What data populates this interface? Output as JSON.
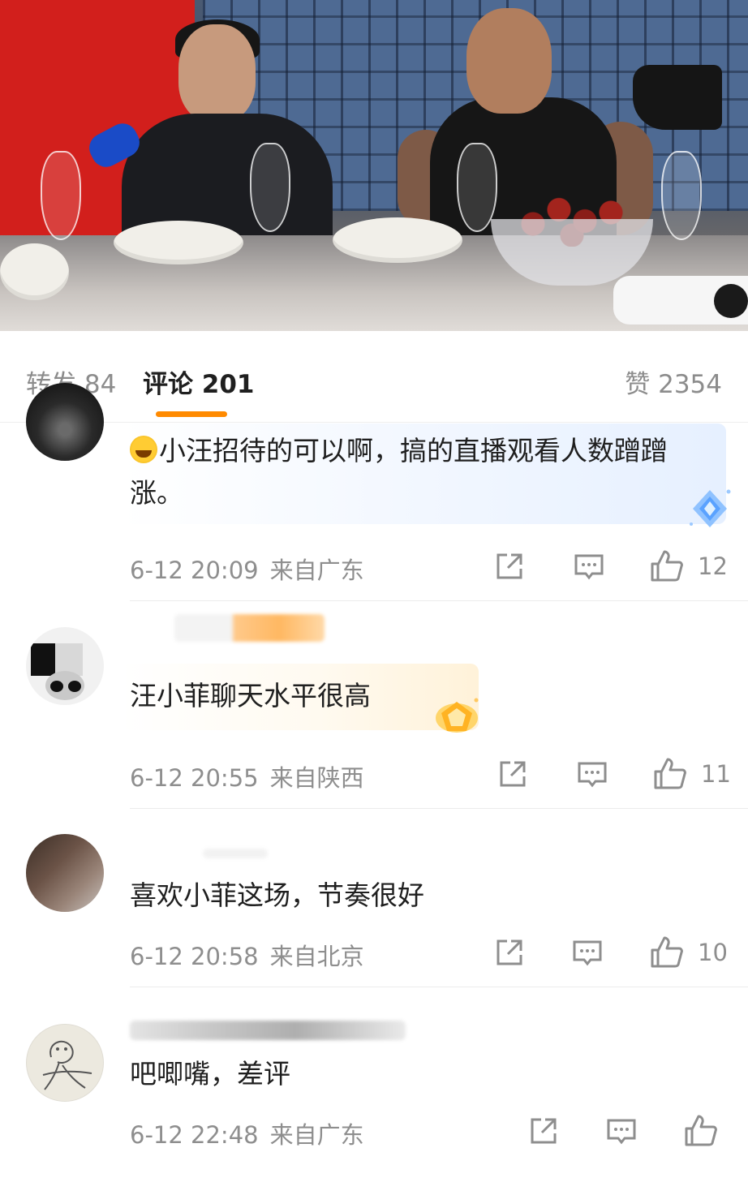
{
  "tabs": {
    "forward_label": "转发 84",
    "comments_label": "评论 201",
    "likes_label": "赞 2354",
    "active_color": "#ff8a00"
  },
  "comments": [
    {
      "text": "小汪招待的可以啊，搞的直播观看人数蹭蹭涨。",
      "emoji_icon": "laughing-crying-emoji",
      "time": "6-12 20:09",
      "location": "来自广东",
      "likes": "12",
      "badge_icon": "diamond-badge-icon"
    },
    {
      "text": "汪小菲聊天水平很高",
      "time": "6-12 20:55",
      "location": "来自陕西",
      "likes": "11",
      "badge_icon": "crown-badge-icon"
    },
    {
      "text": "喜欢小菲这场，节奏很好",
      "time": "6-12 20:58",
      "location": "来自北京",
      "likes": "10"
    },
    {
      "text": "吧唧嘴，差评",
      "time": "6-12 22:48",
      "location": "来自广东",
      "likes": ""
    }
  ],
  "icons": {
    "share": "share-icon",
    "reply": "comment-icon",
    "like": "thumbs-up-icon"
  },
  "colors": {
    "meta_text": "#8e8e8e",
    "body_text": "#1f1f1f"
  }
}
